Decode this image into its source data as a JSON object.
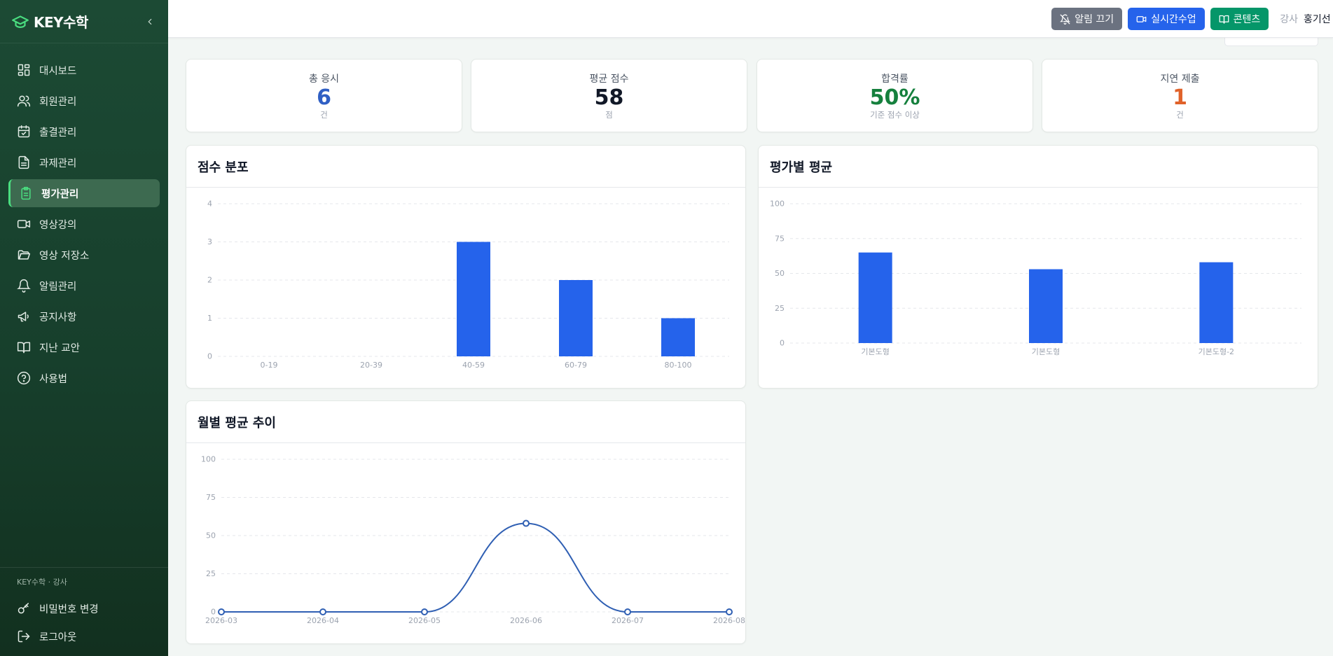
{
  "app": {
    "brand": "KEY수학"
  },
  "sidebar": {
    "items": [
      {
        "label": "대시보드",
        "icon": "dashboard-grid-icon"
      },
      {
        "label": "회원관리",
        "icon": "users-icon"
      },
      {
        "label": "출결관리",
        "icon": "calendar-check-icon"
      },
      {
        "label": "과제관리",
        "icon": "document-icon"
      },
      {
        "label": "평가관리",
        "icon": "clipboard-icon"
      },
      {
        "label": "영상강의",
        "icon": "video-icon"
      },
      {
        "label": "영상 저장소",
        "icon": "folder-open-icon"
      },
      {
        "label": "알림관리",
        "icon": "bell-icon"
      },
      {
        "label": "공지사항",
        "icon": "megaphone-icon"
      },
      {
        "label": "지난 교안",
        "icon": "book-open-icon"
      },
      {
        "label": "사용법",
        "icon": "help-circle-icon"
      }
    ],
    "active_index": 4,
    "footer": {
      "caption": "KEY수학 · 강사",
      "change_password": "비밀번호 변경",
      "logout": "로그아웃"
    }
  },
  "topbar": {
    "mute_alerts": "알림 끄기",
    "live_class": "실시간수업",
    "contents": "콘텐츠",
    "role": "강사",
    "user": "홍기선"
  },
  "stats": [
    {
      "label": "총 응시",
      "value": "6",
      "unit": "건",
      "color": "#2f5fc4"
    },
    {
      "label": "평균 점수",
      "value": "58",
      "unit": "점",
      "color": "#111827"
    },
    {
      "label": "합격률",
      "value": "50%",
      "unit": "기준 점수 이상",
      "color": "#15803d"
    },
    {
      "label": "지연 제출",
      "value": "1",
      "unit": "건",
      "color": "#e0622a"
    }
  ],
  "panels": {
    "score_distribution": "점수 분포",
    "average_by_assessment": "평가별 평균",
    "monthly_trend": "월별 평균 추이"
  },
  "colors": {
    "bar": "#2563eb",
    "line": "#2f5fb3",
    "grid": "#e5e7eb"
  },
  "chart_data": [
    {
      "type": "bar",
      "title": "점수 분포",
      "categories": [
        "0-19",
        "20-39",
        "40-59",
        "60-79",
        "80-100"
      ],
      "values": [
        0,
        0,
        3,
        2,
        1
      ],
      "ylim": [
        0,
        4
      ],
      "yticks": [
        0,
        1,
        2,
        3,
        4
      ],
      "grid": true
    },
    {
      "type": "bar",
      "title": "평가별 평균",
      "categories": [
        "기본도형",
        "기본도형",
        "기본도형-2"
      ],
      "values": [
        65,
        53,
        58
      ],
      "ylim": [
        0,
        100
      ],
      "yticks": [
        0,
        25,
        50,
        75,
        100
      ],
      "grid": true
    },
    {
      "type": "line",
      "title": "월별 평균 추이",
      "categories": [
        "2026-03",
        "2026-04",
        "2026-05",
        "2026-06",
        "2026-07",
        "2026-08"
      ],
      "values": [
        0,
        0,
        0,
        58,
        0,
        0
      ],
      "ylim": [
        0,
        100
      ],
      "yticks": [
        0,
        25,
        50,
        75,
        100
      ],
      "grid": true
    }
  ]
}
